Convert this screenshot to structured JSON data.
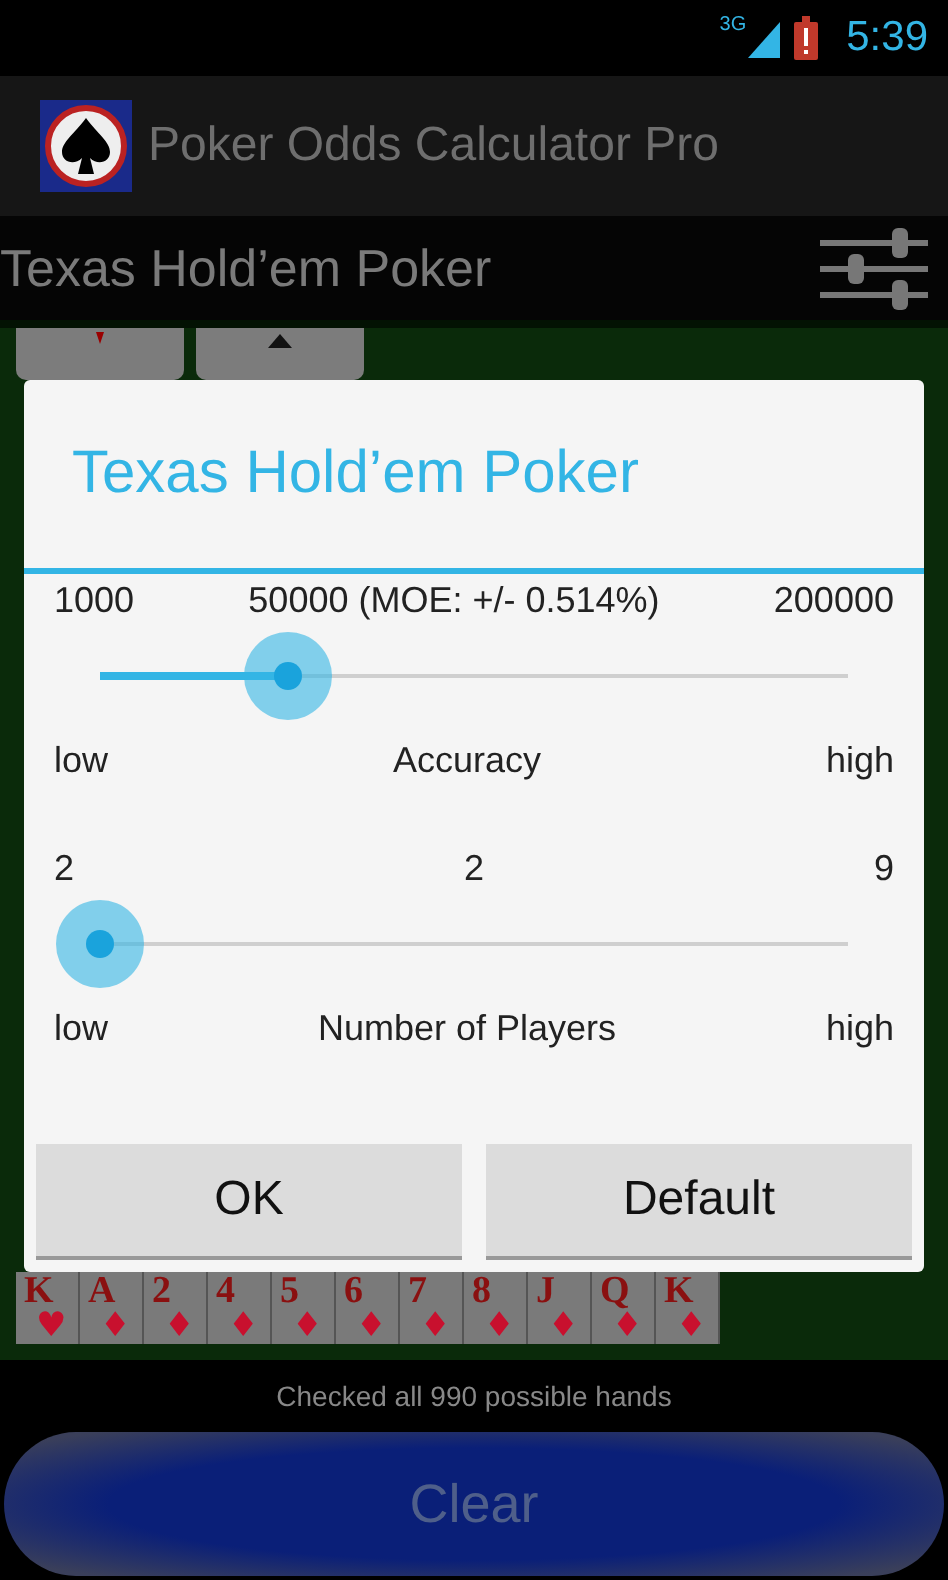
{
  "status_bar": {
    "network": "3G",
    "time": "5:39"
  },
  "app_bar": {
    "title": "Poker Odds Calculator Pro"
  },
  "header": {
    "title": "Texas Hold’em Poker"
  },
  "dialog": {
    "title": "Texas Hold’em Poker",
    "sliders": [
      {
        "min_label": "1000",
        "value_label": "50000 (MOE: +/- 0.514%)",
        "max_label": "200000",
        "level": 0.25,
        "low_label": "low",
        "name": "Accuracy",
        "high_label": "high"
      },
      {
        "min_label": "2",
        "value_label": "2",
        "max_label": "9",
        "low_label": "low",
        "name": "Number of Players",
        "high_label": "high"
      }
    ],
    "buttons": [
      "OK",
      "Default"
    ]
  },
  "cards": [
    {
      "rank": "K",
      "suit": "♥"
    },
    {
      "rank": "A",
      "suit": "♦"
    },
    {
      "rank": "2",
      "suit": "♦"
    },
    {
      "rank": "4",
      "suit": "♦"
    },
    {
      "rank": "5",
      "suit": "♦"
    },
    {
      "rank": "6",
      "suit": "♦"
    },
    {
      "rank": "7",
      "suit": "♦"
    },
    {
      "rank": "8",
      "suit": "♦"
    },
    {
      "rank": "J",
      "suit": "♦"
    },
    {
      "rank": "Q",
      "suit": "♦"
    },
    {
      "rank": "K",
      "suit": "♦"
    }
  ],
  "result": "Checked all 990 possible hands",
  "clear_button": "Clear"
}
